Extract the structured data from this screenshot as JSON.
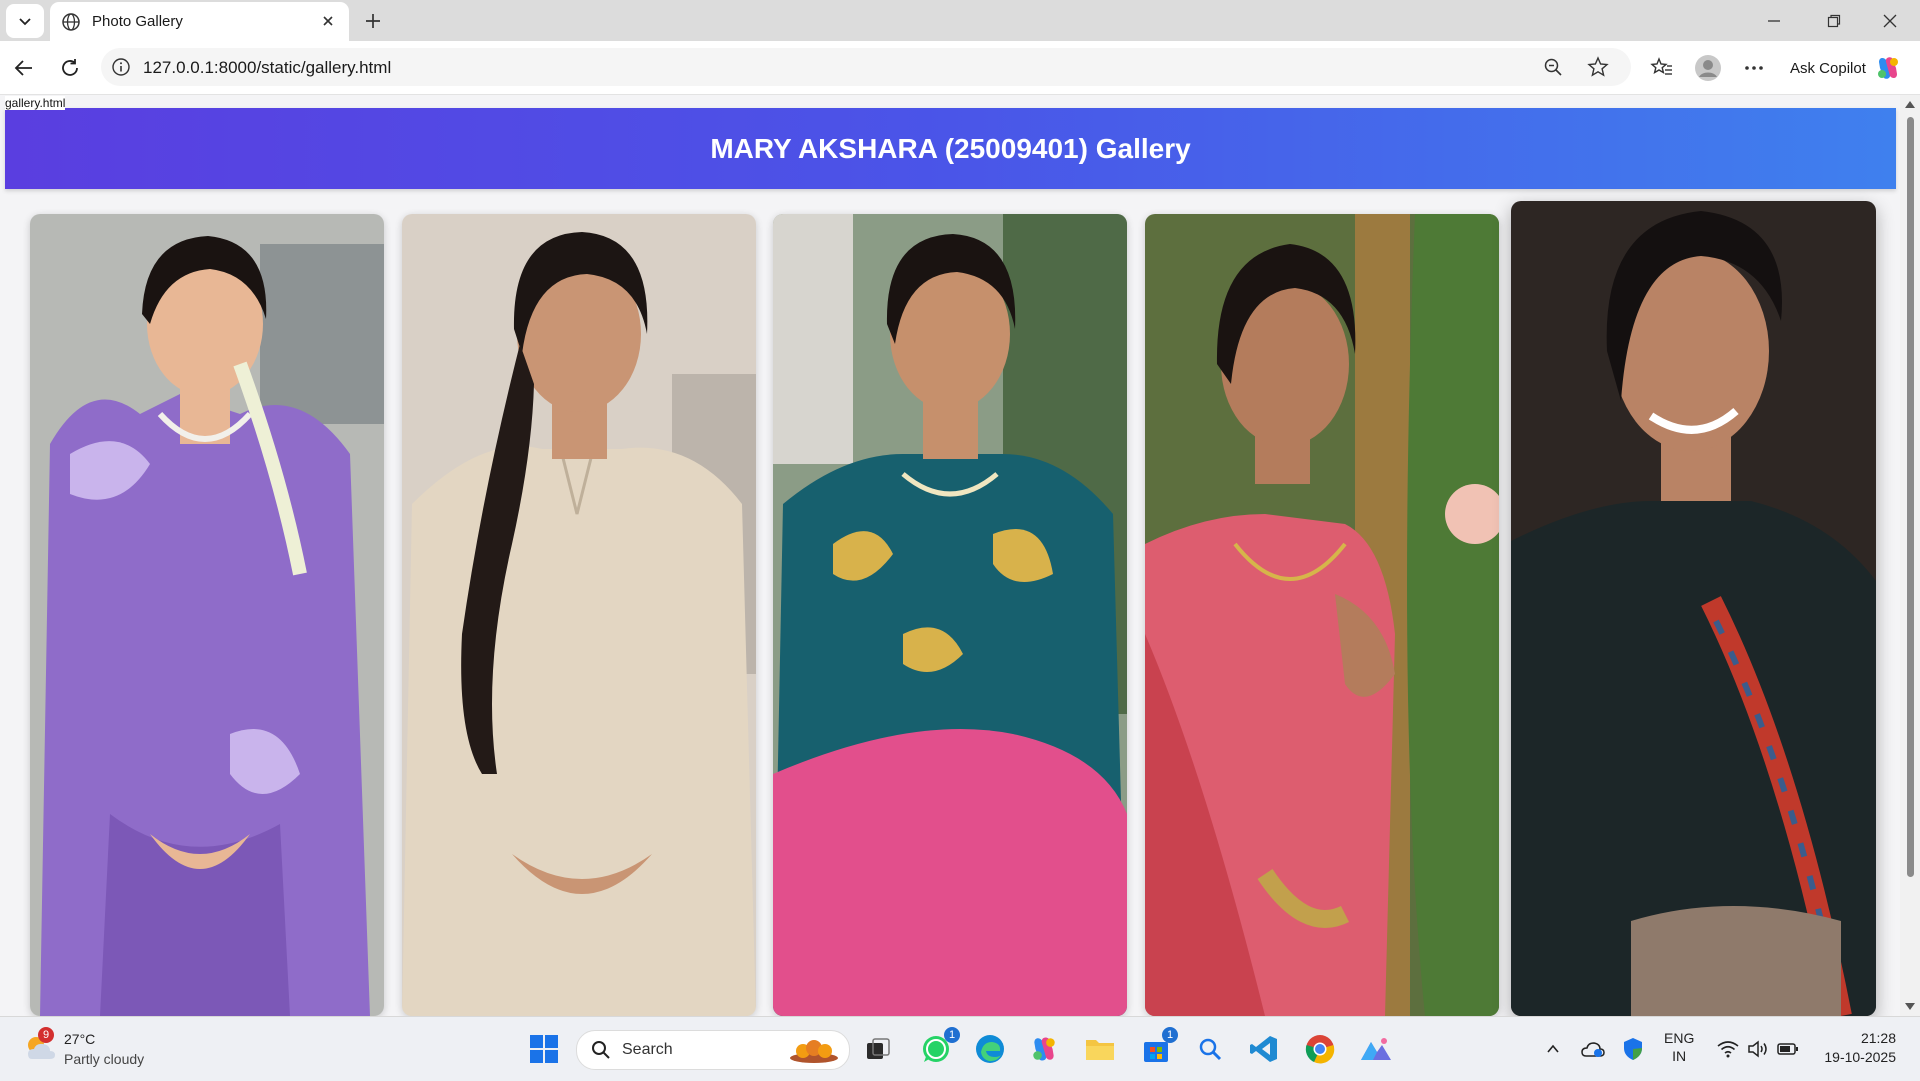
{
  "browser": {
    "tab_title": "Photo Gallery",
    "url": "127.0.0.1:8000/static/gallery.html",
    "copilot_label": "Ask Copilot"
  },
  "page": {
    "tooltip": "gallery.html",
    "heading": "MARY AKSHARA (25009401) Gallery",
    "photos": [
      {
        "name": "photo-purple-dress",
        "bg": "#b7b9b5",
        "dress": "#8f6cc9",
        "accent": "#c9b4ec"
      },
      {
        "name": "photo-beige-kurta",
        "bg": "#d9d0c6",
        "dress": "#e3d6c2",
        "accent": "#bfb09a"
      },
      {
        "name": "photo-teal-churidar",
        "bg": "#8b9c86",
        "dress": "#17606e",
        "accent": "#e24f8c"
      },
      {
        "name": "photo-pink-saree",
        "bg": "#5d6f3e",
        "dress": "#dd5d6f",
        "accent": "#c2a04c"
      },
      {
        "name": "photo-black-shirt",
        "bg": "#2d2623",
        "dress": "#1c2628",
        "accent": "#c0392b"
      }
    ]
  },
  "taskbar": {
    "weather_temp": "27°C",
    "weather_cond": "Partly cloudy",
    "weather_badge": "9",
    "search_label": "Search",
    "whatsapp_badge": "1",
    "store_badge": "1",
    "lang_top": "ENG",
    "lang_bottom": "IN",
    "time": "21:28",
    "date": "19-10-2025"
  }
}
